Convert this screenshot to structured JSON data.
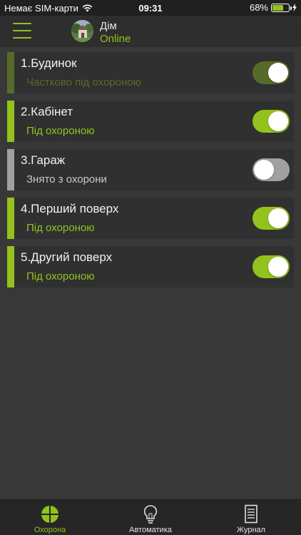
{
  "status_bar": {
    "carrier": "Немає SIM-карти",
    "time": "09:31",
    "battery": "68%",
    "battery_level": 0.68
  },
  "header": {
    "title": "Дім",
    "status": "Online",
    "avatar_icon": "house-photo"
  },
  "colors": {
    "accent": "#93c21d",
    "partial": "#566b29",
    "disarmed": "#a0a0a0",
    "background": "#383838",
    "card": "#303030"
  },
  "groups": [
    {
      "title": "1.Будинок",
      "status": "Частково під охороною",
      "state": "partial"
    },
    {
      "title": "2.Кабінет",
      "status": "Під охороною",
      "state": "armed"
    },
    {
      "title": "3.Гараж",
      "status": "Знято з охорони",
      "state": "disarmed"
    },
    {
      "title": "4.Перший поверх",
      "status": "Під охороною",
      "state": "armed"
    },
    {
      "title": "5.Другий поверх",
      "status": "Під охороною",
      "state": "armed"
    }
  ],
  "tabs": [
    {
      "label": "Охорона",
      "icon": "shield-icon",
      "active": true
    },
    {
      "label": "Автоматика",
      "icon": "lightbulb-icon",
      "active": false
    },
    {
      "label": "Журнал",
      "icon": "journal-icon",
      "active": false
    }
  ]
}
